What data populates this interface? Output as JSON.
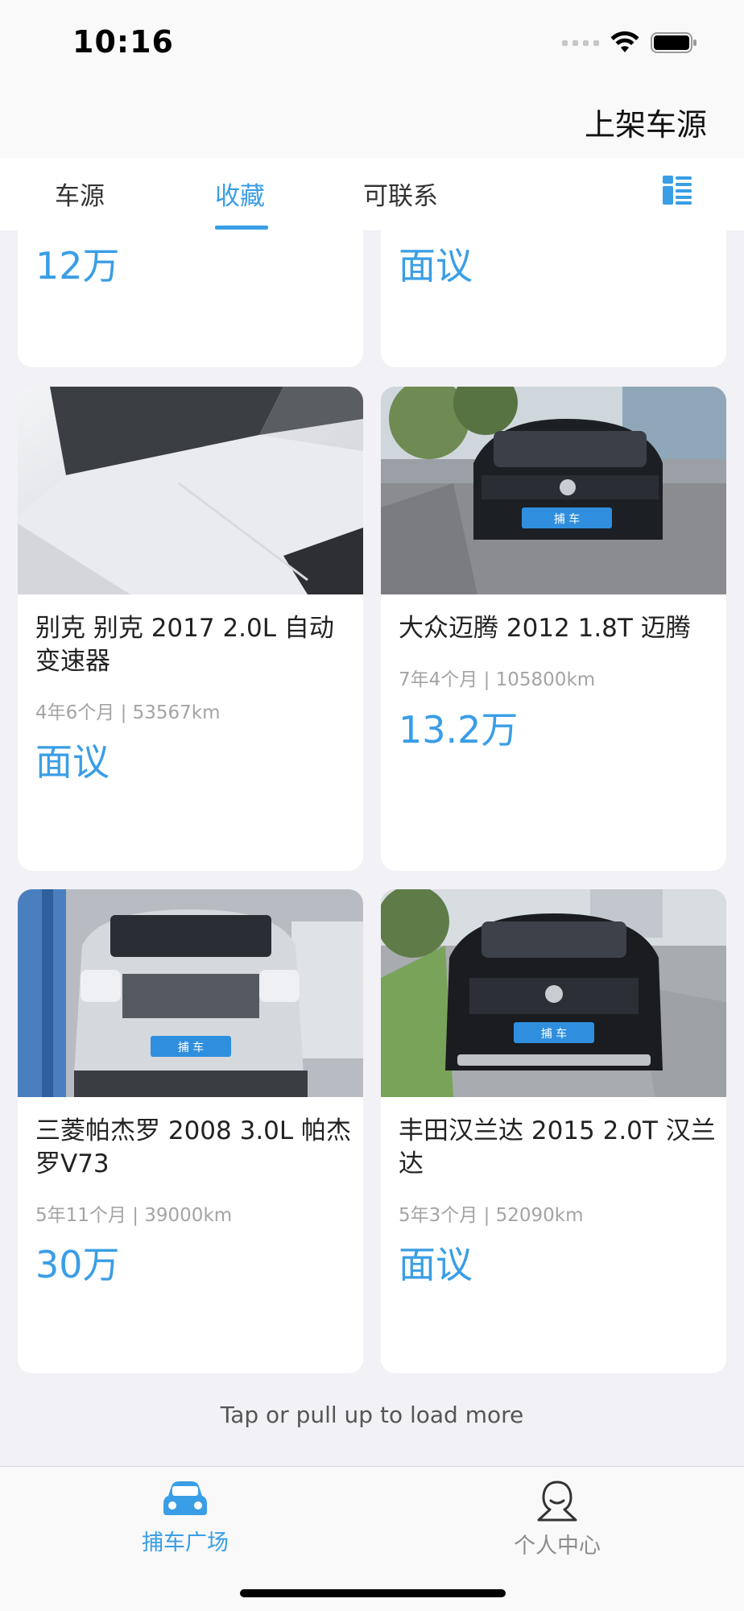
{
  "status_bar": {
    "time": "10:16"
  },
  "header": {
    "publish_label": "上架车源"
  },
  "tabs": [
    {
      "label": "车源",
      "active": false
    },
    {
      "label": "收藏",
      "active": true
    },
    {
      "label": "可联系",
      "active": false
    }
  ],
  "icons": {
    "layout_toggle": "grid-list-icon",
    "car_tab": "car-icon",
    "profile_tab": "person-icon"
  },
  "colors": {
    "accent": "#3a9ee6",
    "meta_text": "#a4a4a4",
    "background": "#f1f1f6"
  },
  "listings": [
    {
      "price": "12万"
    },
    {
      "price": "面议"
    },
    {
      "title": "别克 别克 2017 2.0L 自动变速器",
      "meta": "4年6个月 | 53567km",
      "price": "面议",
      "plate": ""
    },
    {
      "title": "大众迈腾 2012 1.8T 迈腾",
      "meta": "7年4个月 | 105800km",
      "price": "13.2万",
      "plate": "捕 车"
    },
    {
      "title": "三菱帕杰罗 2008 3.0L 帕杰罗V73",
      "meta": "5年11个月 | 39000km",
      "price": "30万",
      "plate": "捕 车"
    },
    {
      "title": "丰田汉兰达 2015 2.0T 汉兰达",
      "meta": "5年3个月 | 52090km",
      "price": "面议",
      "plate": "捕 车"
    }
  ],
  "load_more": "Tap or pull up to load more",
  "bottom_tabs": [
    {
      "label": "捕车广场",
      "active": true
    },
    {
      "label": "个人中心",
      "active": false
    }
  ]
}
